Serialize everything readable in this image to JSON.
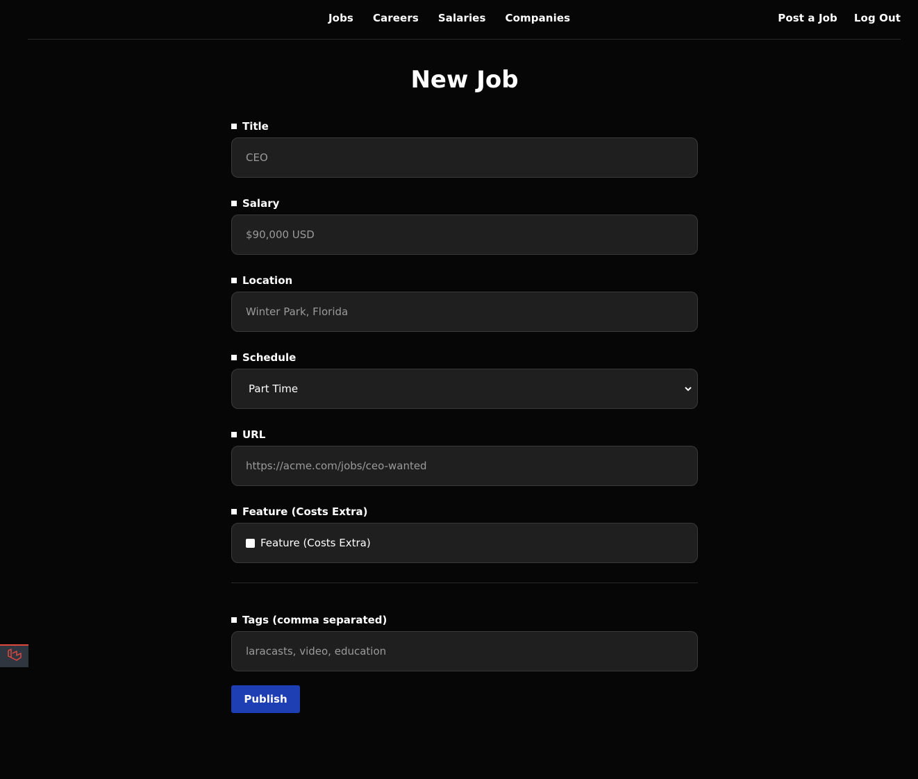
{
  "nav": {
    "center_links": [
      "Jobs",
      "Careers",
      "Salaries",
      "Companies"
    ],
    "right_links": [
      "Post a Job",
      "Log Out"
    ]
  },
  "page": {
    "title": "New Job"
  },
  "form": {
    "title": {
      "label": "Title",
      "placeholder": "CEO"
    },
    "salary": {
      "label": "Salary",
      "placeholder": "$90,000 USD"
    },
    "location": {
      "label": "Location",
      "placeholder": "Winter Park, Florida"
    },
    "schedule": {
      "label": "Schedule",
      "value": "Part Time"
    },
    "url": {
      "label": "URL",
      "placeholder": "https://acme.com/jobs/ceo-wanted"
    },
    "feature": {
      "label": "Feature (Costs Extra)",
      "checkbox_label": "Feature (Costs Extra)",
      "checked": false
    },
    "tags": {
      "label": "Tags (comma separated)",
      "placeholder": "laracasts, video, education"
    },
    "submit_label": "Publish"
  },
  "icons": {
    "chevron": "chevron-down-icon",
    "debug": "laravel-logo-icon"
  },
  "colors": {
    "background": "#060606",
    "input_bg": "#1f1f1f",
    "input_border": "#3a3a3a",
    "primary_button": "#1d3fb3",
    "debug_accent": "#e0483e"
  }
}
